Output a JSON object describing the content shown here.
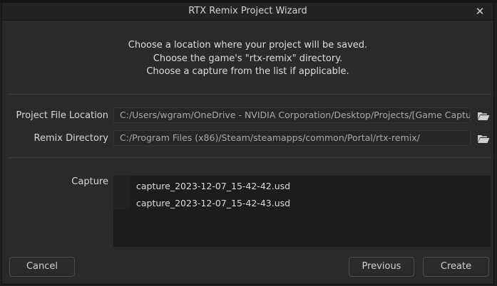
{
  "window": {
    "title": "RTX Remix Project Wizard",
    "close_glyph": "✕"
  },
  "instructions": [
    "Choose a location where your project will be saved.",
    "Choose the game's \"rtx-remix\" directory.",
    "Choose a capture from the list if applicable."
  ],
  "fields": {
    "project_file": {
      "label": "Project File Location",
      "value": "C:/Users/wgram/OneDrive - NVIDIA Corporation/Desktop/Projects/[Game Captu",
      "icon": "folder-open-icon"
    },
    "remix_directory": {
      "label": "Remix Directory",
      "value": "C:/Program Files (x86)/Steam/steamapps/common/Portal/rtx-remix/",
      "icon": "folder-open-icon"
    }
  },
  "capture": {
    "label": "Capture",
    "items": [
      "capture_2023-12-07_15-42-42.usd",
      "capture_2023-12-07_15-42-43.usd"
    ]
  },
  "buttons": {
    "cancel": "Cancel",
    "previous": "Previous",
    "create": "Create"
  },
  "colors": {
    "background": "#2a2a2a",
    "field": "#262626",
    "list": "#1c1c1c",
    "folder": "#cfcfcf"
  }
}
